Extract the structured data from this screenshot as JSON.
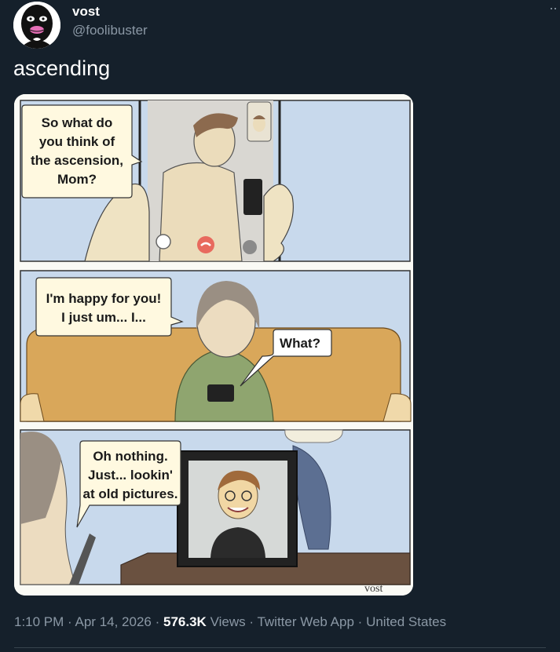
{
  "author": {
    "display_name": "vost",
    "handle": "@foolibuster",
    "avatar_icon": "masked-face-avatar"
  },
  "tweet": {
    "text": "ascending",
    "more_icon": "more-icon"
  },
  "comic": {
    "panel1": {
      "speech": [
        "So what do",
        "you think of",
        "the ascension,",
        "Mom?"
      ]
    },
    "panel2": {
      "speech_left": [
        "I'm happy for you!",
        "I just um... I..."
      ],
      "speech_right": [
        "What?"
      ]
    },
    "panel3": {
      "speech": [
        "Oh nothing.",
        "Just... lookin'",
        "at old pictures."
      ]
    },
    "signature": "vost"
  },
  "meta": {
    "time": "1:10 PM",
    "date": "Apr 14, 2026",
    "views_count": "576.3K",
    "views_label": "Views",
    "source": "Twitter Web App",
    "location": "United States",
    "separator": "·"
  },
  "colors": {
    "background": "#15202b",
    "text_primary": "#ffffff",
    "text_secondary": "#8b98a5",
    "divider": "#38444d"
  }
}
